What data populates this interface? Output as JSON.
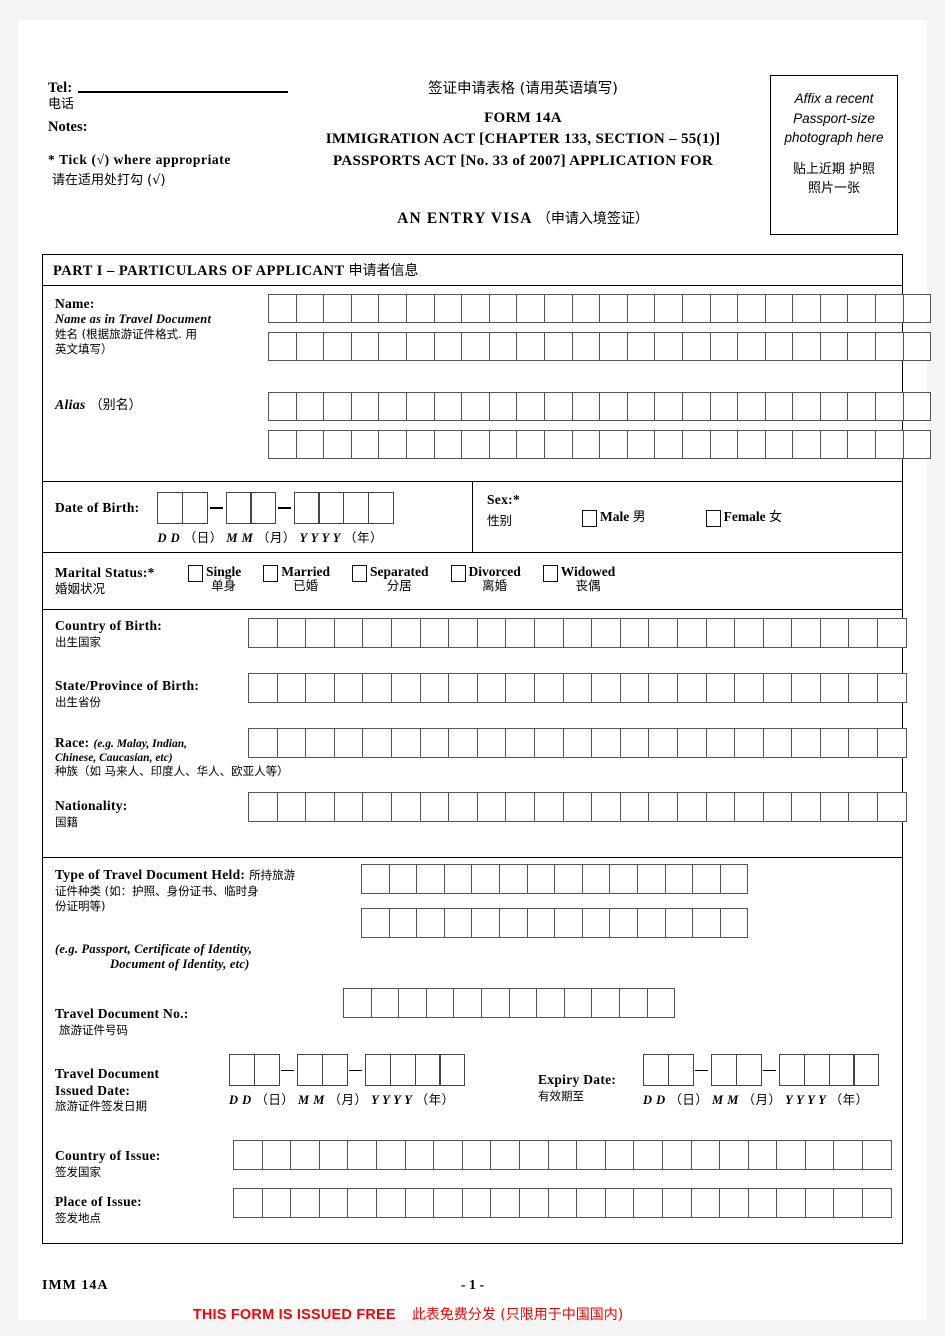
{
  "header": {
    "tel_label": "Tel:",
    "tel_label_cn": "电话",
    "notes_label": "Notes:",
    "tick_en": "* Tick (√) where appropriate",
    "tick_cn": "请在适用处打勾 (√)",
    "title_cn": "签证申请表格 (请用英语填写)",
    "form_no": "FORM 14A",
    "act_line1": "IMMIGRATION ACT [CHAPTER 133, SECTION – 55(1)]",
    "act_line2": "PASSPORTS ACT [No. 33 of 2007] APPLICATION FOR",
    "visa_en": "AN ENTRY VISA",
    "visa_cn": "（申请入境签证）",
    "photo_en": "Affix a recent Passport-size photograph here",
    "photo_cn_line1": "贴上近期 护照",
    "photo_cn_line2": "照片一张"
  },
  "part1": {
    "title_en": "PART I – PARTICULARS OF APPLICANT",
    "title_cn": "申请者信息",
    "name": {
      "label": "Name:",
      "sub_en": "Name as in Travel Document",
      "sub_cn_line1": "姓名 (根据旅游证件格式. 用",
      "sub_cn_line2": "英文填写）",
      "boxes_per_row": 24,
      "rows": 2
    },
    "alias": {
      "label_en": "Alias",
      "label_cn": "（别名）",
      "boxes_per_row": 24,
      "rows": 2
    },
    "dob": {
      "label": "Date of Birth:",
      "dd_boxes": 2,
      "mm_boxes": 2,
      "yyyy_boxes": 4,
      "legend_dd": "D D",
      "legend_dd_cn": "（日）",
      "legend_mm": "M M",
      "legend_mm_cn": "（月）",
      "legend_yyyy": "Y Y Y Y",
      "legend_yyyy_cn": "（年）"
    },
    "sex": {
      "label": "Sex:*",
      "label_cn": "性别",
      "options": [
        {
          "en": "Male",
          "cn": "男"
        },
        {
          "en": "Female",
          "cn": "女"
        }
      ]
    },
    "marital": {
      "label": "Marital Status:*",
      "label_cn": "婚姻状况",
      "options": [
        {
          "en": "Single",
          "cn": "单身"
        },
        {
          "en": "Married",
          "cn": "已婚"
        },
        {
          "en": "Separated",
          "cn": "分居"
        },
        {
          "en": "Divorced",
          "cn": "离婚"
        },
        {
          "en": "Widowed",
          "cn": "丧偶"
        }
      ]
    },
    "country_of_birth": {
      "label": "Country of Birth:",
      "label_cn": "出生国家",
      "boxes": 23
    },
    "state_of_birth": {
      "label": "State/Province of Birth:",
      "label_cn": "出生省份",
      "boxes": 23
    },
    "race": {
      "label": "Race:",
      "label_eg": "(e.g. Malay, Indian,",
      "label_eg2": "Chinese, Caucasian, etc)",
      "label_cn": "种族（如 马来人、印度人、华人、欧亚人等）",
      "boxes": 23
    },
    "nationality": {
      "label": "Nationality:",
      "label_cn": "国籍",
      "boxes": 23
    },
    "travel_doc_type": {
      "label": "Type of Travel Document Held:",
      "label_cn1": "所持旅游",
      "label_cn2": "证件种类 (如：护照、身份证书、临时身",
      "label_cn3": "份证明等)",
      "eg_line1": "(e.g.  Passport, Certificate of Identity,",
      "eg_line2": "Document of Identity, etc)",
      "boxes_per_row": 14,
      "rows": 2
    },
    "travel_doc_no": {
      "label": "Travel Document No.:",
      "label_cn": "旅游证件号码",
      "boxes": 12
    },
    "issued_date": {
      "label_line1": "Travel Document",
      "label_line2": "Issued Date:",
      "label_cn": "旅游证件签发日期",
      "legend_dd": "D D",
      "legend_dd_cn": "（日）",
      "legend_mm": "M M",
      "legend_mm_cn": "（月）",
      "legend_yyyy": "Y Y Y Y",
      "legend_yyyy_cn": "（年）"
    },
    "expiry_date": {
      "label": "Expiry Date:",
      "label_cn": "有效期至",
      "legend_dd": "D D",
      "legend_dd_cn": "（日）",
      "legend_mm": "M M",
      "legend_mm_cn": "（月）",
      "legend_yyyy": "Y Y Y Y",
      "legend_yyyy_cn": "（年）"
    },
    "country_of_issue": {
      "label": "Country of Issue:",
      "label_cn": "签发国家",
      "boxes": 23
    },
    "place_of_issue": {
      "label": "Place of Issue:",
      "label_cn": "签发地点",
      "boxes": 23
    }
  },
  "footer": {
    "form_code": "IMM  14A",
    "page_number": "- 1 -",
    "free_en": "THIS FORM IS ISSUED FREE",
    "free_cn": "此表免费分发 (只限用于中国国内)",
    "free_color": "#ff0000"
  }
}
